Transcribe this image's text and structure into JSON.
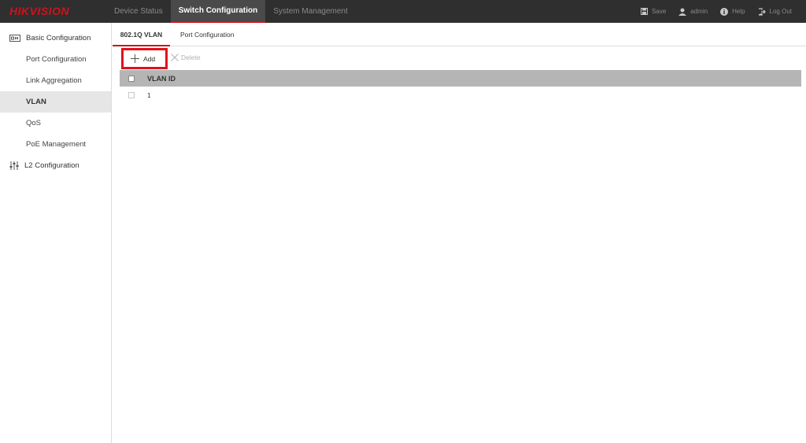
{
  "header": {
    "logo": "HIKVISION",
    "nav": [
      {
        "label": "Device Status"
      },
      {
        "label": "Switch Configuration"
      },
      {
        "label": "System Management"
      }
    ],
    "right": {
      "save": "Save",
      "user": "admin",
      "help": "Help",
      "logout": "Log Out"
    }
  },
  "sidebar": {
    "groups": [
      {
        "label": "Basic Configuration"
      },
      {
        "label": "L2 Configuration"
      }
    ],
    "items": [
      {
        "label": "Port Configuration"
      },
      {
        "label": "Link Aggregation"
      },
      {
        "label": "VLAN"
      },
      {
        "label": "QoS"
      },
      {
        "label": "PoE Management"
      }
    ]
  },
  "tabs": [
    {
      "label": "802.1Q VLAN"
    },
    {
      "label": "Port Configuration"
    }
  ],
  "toolbar": {
    "add": "Add",
    "delete": "Delete"
  },
  "table": {
    "headers": [
      "VLAN ID"
    ],
    "rows": [
      [
        "1"
      ]
    ]
  },
  "colors": {
    "accent": "#d0121b",
    "topbar": "#2f2f2f",
    "table_header": "#b5b5b5"
  }
}
